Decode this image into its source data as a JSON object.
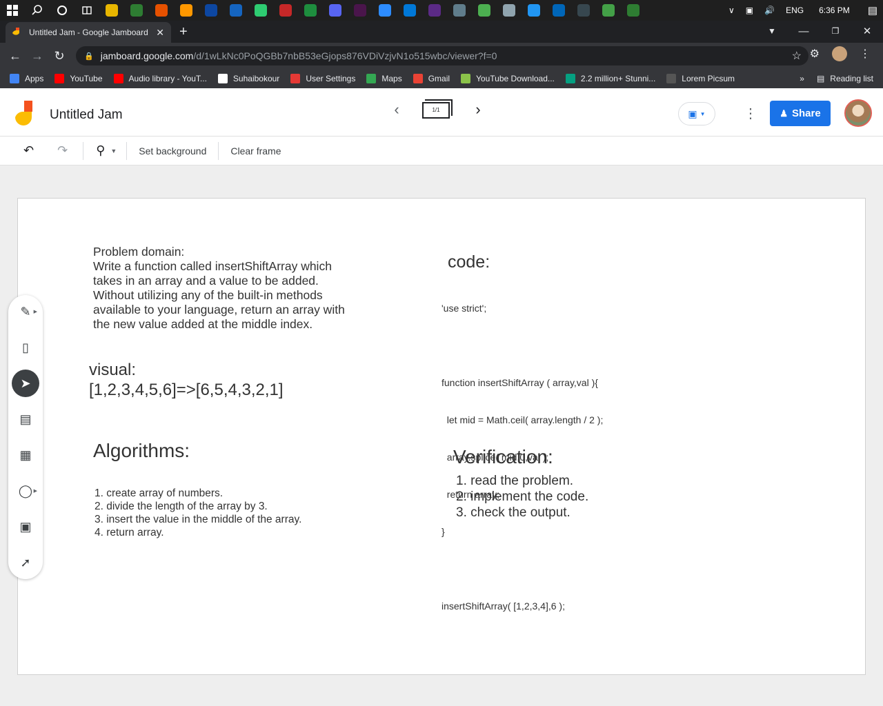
{
  "taskbar": {
    "apps": [
      "#e8b600",
      "#2e7d32",
      "#e65100",
      "#ff9800",
      "#0d47a1",
      "#1565c0",
      "#2ecc71",
      "#c62828",
      "#1e8e3e",
      "#5865f2",
      "#4a154b",
      "#2d8cff",
      "#0078d7",
      "#5b2a86",
      "#607d8b",
      "#4caf50",
      "#90a4ae",
      "#2196f3",
      "#0066b8",
      "#37474f",
      "#43a047",
      "#2e7d32"
    ],
    "lang": "ENG",
    "time": "6:36 PM"
  },
  "tab": {
    "title": "Untitled Jam - Google Jamboard"
  },
  "address": {
    "host": "jamboard.google.com",
    "path": "/d/1wLkNc0PoQGBb7nbB53eGjops876VDiVzjvN1o515wbc/viewer?f=0"
  },
  "bookmarks": {
    "items": [
      {
        "label": "Apps",
        "color": "#4285f4"
      },
      {
        "label": "YouTube",
        "color": "#ff0000"
      },
      {
        "label": "Audio library - YouT...",
        "color": "#ff0000"
      },
      {
        "label": "Suhaibokour",
        "color": "#ffffff"
      },
      {
        "label": "User Settings",
        "color": "#e53935"
      },
      {
        "label": "Maps",
        "color": "#34a853"
      },
      {
        "label": "Gmail",
        "color": "#ea4335"
      },
      {
        "label": "YouTube Download...",
        "color": "#8bc34a"
      },
      {
        "label": "2.2 million+ Stunni...",
        "color": "#05a081"
      },
      {
        "label": "Lorem Picsum",
        "color": "#555555"
      }
    ],
    "more": "»",
    "reading_list": "Reading list"
  },
  "jam": {
    "title": "Untitled Jam",
    "frame_indicator": "1/1",
    "share_label": "Share"
  },
  "toolbar": {
    "set_background": "Set background",
    "clear_frame": "Clear frame"
  },
  "board": {
    "problem_domain": {
      "heading": "Problem domain:",
      "lines": [
        "Write a function called insertShiftArray which",
        "takes in an array and a value to be added.",
        "Without utilizing any of the built-in methods",
        "available to your language, return an array with",
        "the new value added at the middle index."
      ]
    },
    "visual": {
      "heading": "visual:",
      "text": "[1,2,3,4,5,6]=>[6,5,4,3,2,1]"
    },
    "code": {
      "heading": "code:",
      "lines": [
        "'use strict';",
        "",
        "function insertShiftArray ( array,val ){",
        "  let mid = Math.ceil( array.length / 2 );",
        "  array.splice( mid,0,val );",
        "  return array;",
        "}",
        "",
        "insertShiftArray( [1,2,3,4],6 );"
      ]
    },
    "algorithms": {
      "heading": "Algorithms:",
      "items": [
        "1. create array of numbers.",
        "2. divide the length of the array by 3.",
        "3. insert the value in the middle of the array.",
        "4. return array."
      ]
    },
    "verification": {
      "heading": "Verification:",
      "items": [
        "1. read the problem.",
        "2. implement the code.",
        "3. check the output."
      ]
    }
  }
}
